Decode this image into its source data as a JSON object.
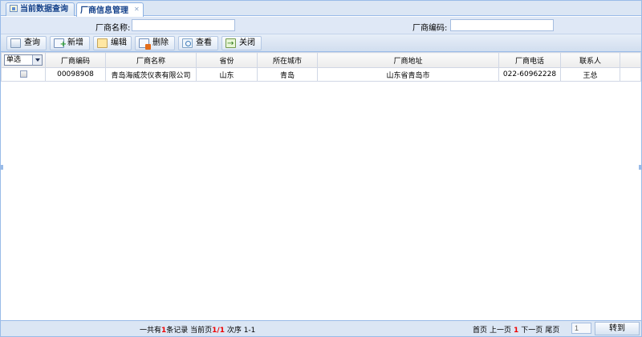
{
  "tabs": [
    {
      "label": "当前数据查询",
      "active": false,
      "icon": "home-icon"
    },
    {
      "label": "厂商信息管理",
      "active": true,
      "icon": "close-icon"
    }
  ],
  "search": {
    "name_label": "厂商名称:",
    "name_value": "",
    "code_label": "厂商编码:",
    "code_value": ""
  },
  "toolbar": {
    "query": "查询",
    "add": "新增",
    "edit": "编辑",
    "delete": "删除",
    "view": "查看",
    "close": "关闭"
  },
  "table": {
    "select_mode": "单选",
    "columns": [
      "厂商编码",
      "厂商名称",
      "省份",
      "所在城市",
      "厂商地址",
      "厂商电话",
      "联系人"
    ],
    "rows": [
      {
        "code": "00098908",
        "name": "青岛海威茨仪表有限公司",
        "province": "山东",
        "city": "青岛",
        "address": "山东省青岛市",
        "phone": "022-60962228",
        "contact": "王总"
      }
    ]
  },
  "footer": {
    "total_prefix": "一共有",
    "total_count": "1",
    "total_suffix": "条记录 当前页",
    "page_current": "1/1",
    "order_label": "次序 1-1",
    "first": "首页",
    "prev": "上一页",
    "page_num": "1",
    "next": "下一页",
    "last": "尾页",
    "jump_value": "1",
    "go": "转到"
  },
  "colors": {
    "accent": "#15428b",
    "border": "#99bbe8",
    "highlight": "#ee0000"
  }
}
